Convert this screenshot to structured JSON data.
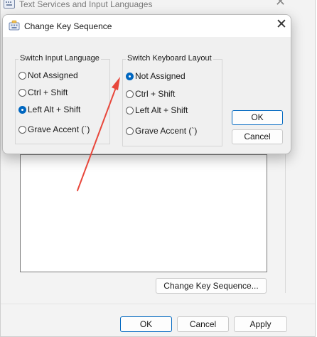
{
  "background_window": {
    "title": "Text Services and Input Languages",
    "buttons": {
      "change_key_sequence": "Change Key Sequence...",
      "ok": "OK",
      "cancel": "Cancel",
      "apply": "Apply"
    }
  },
  "dialog": {
    "title": "Change Key Sequence",
    "switch_input_language": {
      "label": "Switch Input Language",
      "options": [
        "Not Assigned",
        "Ctrl + Shift",
        "Left Alt + Shift",
        "Grave Accent (`)"
      ],
      "selected": "Left Alt + Shift"
    },
    "switch_keyboard_layout": {
      "label": "Switch Keyboard Layout",
      "options": [
        "Not Assigned",
        "Ctrl + Shift",
        "Left Alt + Shift",
        "Grave Accent (`)"
      ],
      "selected": "Not Assigned"
    },
    "buttons": {
      "ok": "OK",
      "cancel": "Cancel"
    }
  },
  "annotation": {
    "type": "arrow",
    "color": "#e8473b"
  },
  "colors": {
    "accent": "#0067c0",
    "arrow": "#e8473b"
  }
}
